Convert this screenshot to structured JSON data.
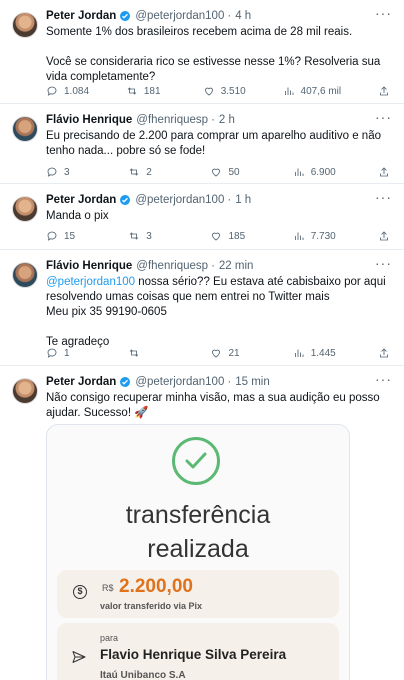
{
  "tweets": [
    {
      "name": "Peter Jordan",
      "verified": true,
      "handle": "@peterjordan100",
      "time": "4 h",
      "text": "Somente 1% dos brasileiros recebem acima de 28 mil reais.\n\nVocê se consideraria rico se estivesse nesse 1%? Resolveria sua vida completamente?",
      "replies": "1.084",
      "retweets": "181",
      "likes": "3.510",
      "views": "407,6 mil"
    },
    {
      "name": "Flávio Henrique",
      "verified": false,
      "handle": "@fhenriquesp",
      "time": "2 h",
      "text": "Eu precisando de 2.200 para comprar um aparelho auditivo e não tenho nada... pobre só se fode!",
      "replies": "3",
      "retweets": "2",
      "likes": "50",
      "views": "6.900"
    },
    {
      "name": "Peter Jordan",
      "verified": true,
      "handle": "@peterjordan100",
      "time": "1 h",
      "text": "Manda o pix",
      "replies": "15",
      "retweets": "3",
      "likes": "185",
      "views": "7.730"
    },
    {
      "name": "Flávio Henrique",
      "verified": false,
      "handle": "@fhenriquesp",
      "time": "22 min",
      "mention": "@peterjordan100",
      "text": " nossa sério?? Eu estava até cabisbaixo por aqui resolvendo umas coisas que nem entrei no Twitter mais\nMeu pix 35 99190-0605\n\nTe agradeço",
      "replies": "1",
      "retweets": "",
      "likes": "21",
      "views": "1.445"
    },
    {
      "name": "Peter Jordan",
      "verified": true,
      "handle": "@peterjordan100",
      "time": "15 min",
      "text": "Não consigo recuperar minha visão, mas a sua audição eu posso ajudar. Sucesso! 🚀"
    }
  ],
  "receipt": {
    "title_line1": "transferência",
    "title_line2": "realizada",
    "currency": "R$",
    "amount": "2.200,00",
    "amount_label": "valor transferido via Pix",
    "to_label": "para",
    "recipient": "Flavio Henrique Silva Pereira",
    "bank": "Itaú Unibanco S.A"
  },
  "icons": {
    "reply": "reply-icon",
    "retweet": "retweet-icon",
    "like": "heart-icon",
    "views": "views-icon",
    "share": "share-icon",
    "more": "more-icon",
    "verified": "verified-badge-icon"
  },
  "colors": {
    "link": "#1d9bf0",
    "muted": "#536471",
    "success": "#5bb974",
    "amount": "#e0721b"
  }
}
